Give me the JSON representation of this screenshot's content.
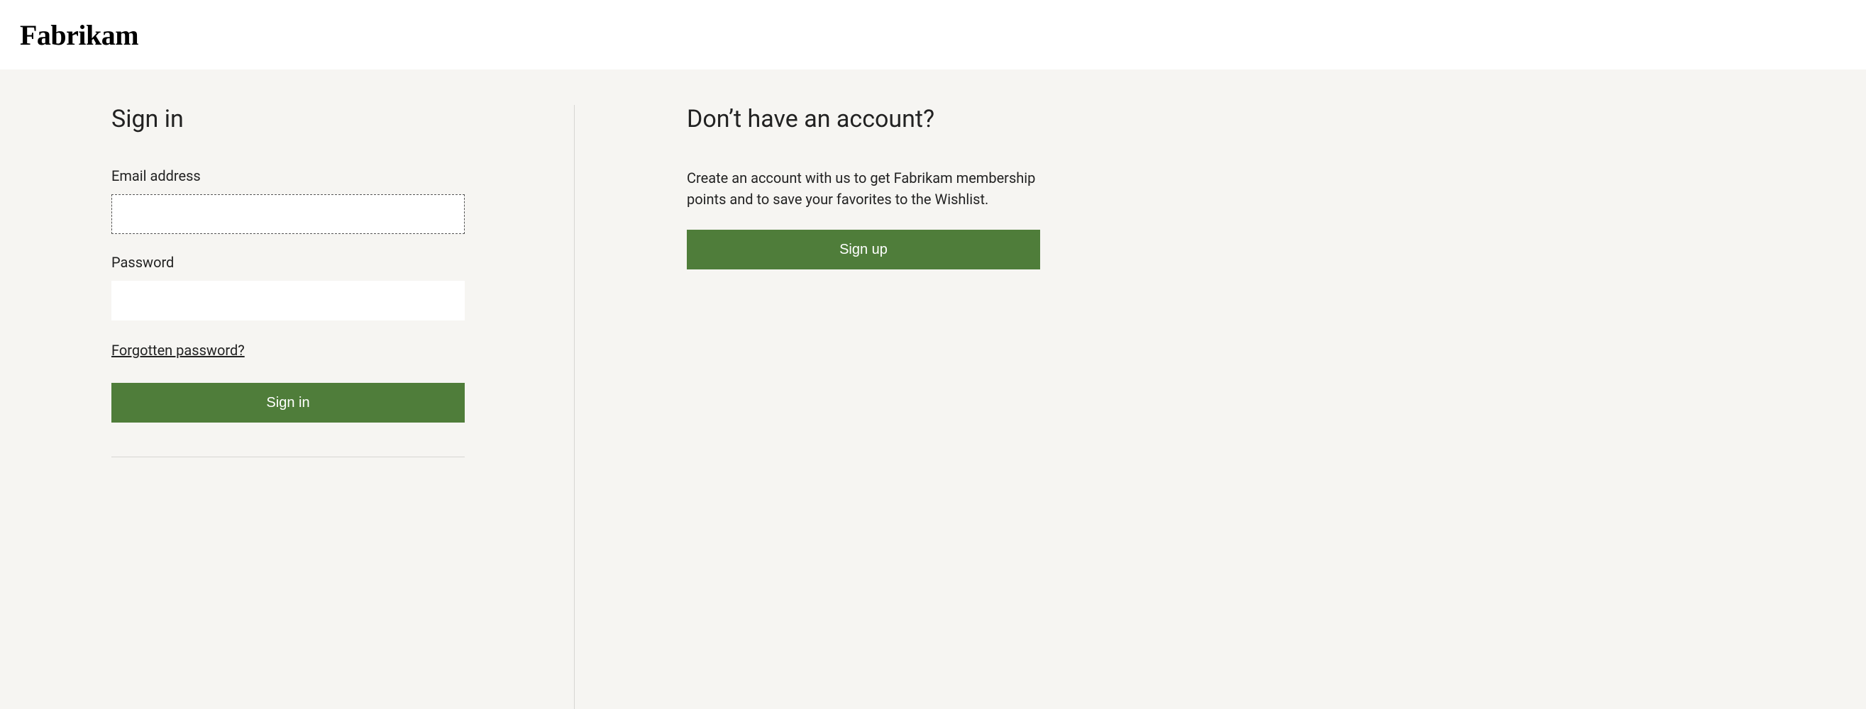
{
  "header": {
    "logo_text": "Fabrikam"
  },
  "signin": {
    "title": "Sign in",
    "email_label": "Email address",
    "email_value": "",
    "password_label": "Password",
    "password_value": "",
    "forgot_link": "Forgotten password?",
    "submit_label": "Sign in"
  },
  "signup": {
    "title": "Don’t have an account?",
    "description": "Create an account with us to get Fabrikam membership points and to save your favorites to the Wishlist.",
    "button_label": "Sign up"
  },
  "colors": {
    "accent": "#4f7d3a",
    "page_bg": "#f6f5f2"
  }
}
